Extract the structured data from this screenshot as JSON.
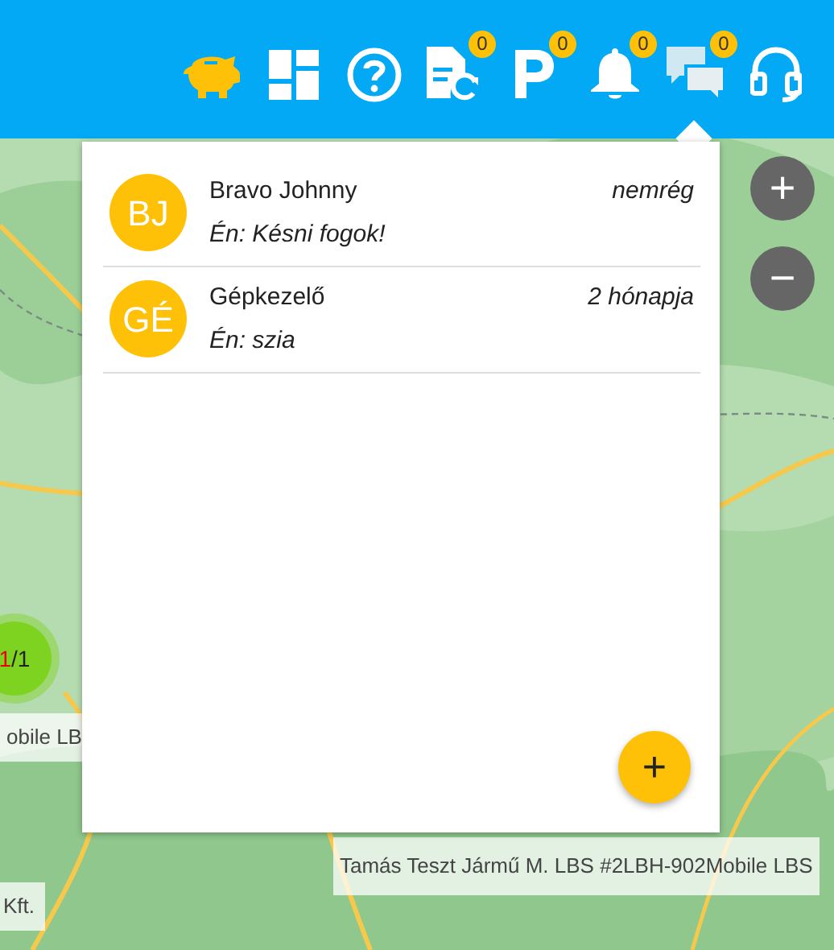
{
  "map": {
    "kind": "picture"
  },
  "toolbar": [
    {
      "kind": "piggy",
      "highlighted": true
    },
    {
      "kind": "dashboard",
      "highlighted": false
    },
    {
      "kind": "help",
      "highlighted": false
    },
    {
      "kind": "document-refresh",
      "badge": "0",
      "highlighted": false
    },
    {
      "kind": "parking",
      "badge": "0",
      "highlighted": false
    },
    {
      "kind": "bell",
      "badge": "0",
      "highlighted": false
    },
    {
      "kind": "chat",
      "badge": "0",
      "highlighted": false,
      "selected": true
    },
    {
      "kind": "headset",
      "highlighted": false
    }
  ],
  "zoom_controls": [
    "+",
    "−"
  ],
  "cluster": {
    "alert_count": "1",
    "suffix": "/1"
  },
  "map_labels": [
    "obile LB",
    "Kft.",
    "Tamás Teszt Jármű M. LBS #2LBH-902Mobile LBS"
  ],
  "conversations": [
    {
      "initials": "BJ",
      "name": "Bravo Johnny",
      "time": "nemrég",
      "last_message": "Én: Késni fogok!"
    },
    {
      "initials": "GÉ",
      "name": "Gépkezelő",
      "time": "2 hónapja",
      "last_message": "Én: szia"
    }
  ],
  "new_button": "+"
}
